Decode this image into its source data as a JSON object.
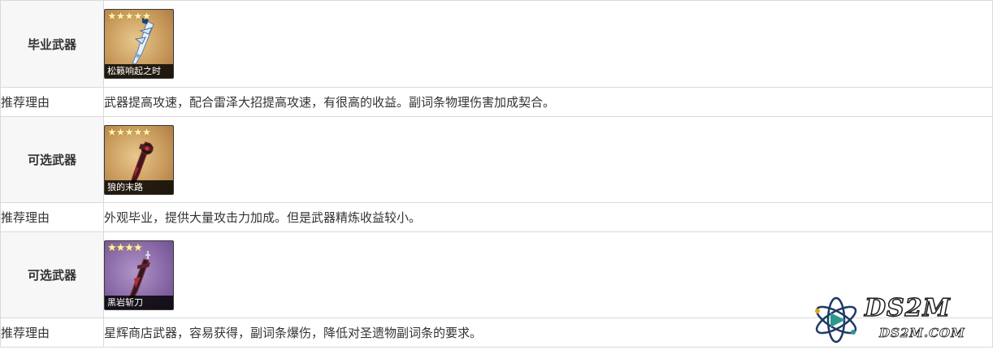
{
  "rows": [
    {
      "label": "毕业武器",
      "weapon": {
        "name": "松籁响起之时",
        "stars": "★★★★★",
        "rarity": 5,
        "theme": "gold",
        "icon": "greatsword-song-of-broken-pines-icon"
      },
      "reason_label": "推荐理由",
      "reason": "武器提高攻速，配合雷泽大招提高攻速，有很高的收益。副词条物理伤害加成契合。"
    },
    {
      "label": "可选武器",
      "weapon": {
        "name": "狼的末路",
        "stars": "★★★★★",
        "rarity": 5,
        "theme": "gold",
        "icon": "greatsword-wolfs-gravestone-icon"
      },
      "reason_label": "推荐理由",
      "reason": "外观毕业，提供大量攻击力加成。但是武器精炼收益较小。"
    },
    {
      "label": "可选武器",
      "weapon": {
        "name": "黑岩斩刀",
        "stars": "★★★★",
        "rarity": 4,
        "theme": "purple",
        "icon": "greatsword-blackcliff-slasher-icon"
      },
      "reason_label": "推荐理由",
      "reason": "星辉商店武器，容易获得，副词条爆伤，降低对圣遗物副词条的要求。"
    }
  ],
  "watermark": {
    "title": "DS2M",
    "url": "DS2M.COM",
    "icon": "atom-logo-icon"
  },
  "colors": {
    "label_bg": "#f7f7f7",
    "border": "#d9d9d9",
    "gold_card": "#c99b5d",
    "purple_card": "#8a6aa8"
  }
}
